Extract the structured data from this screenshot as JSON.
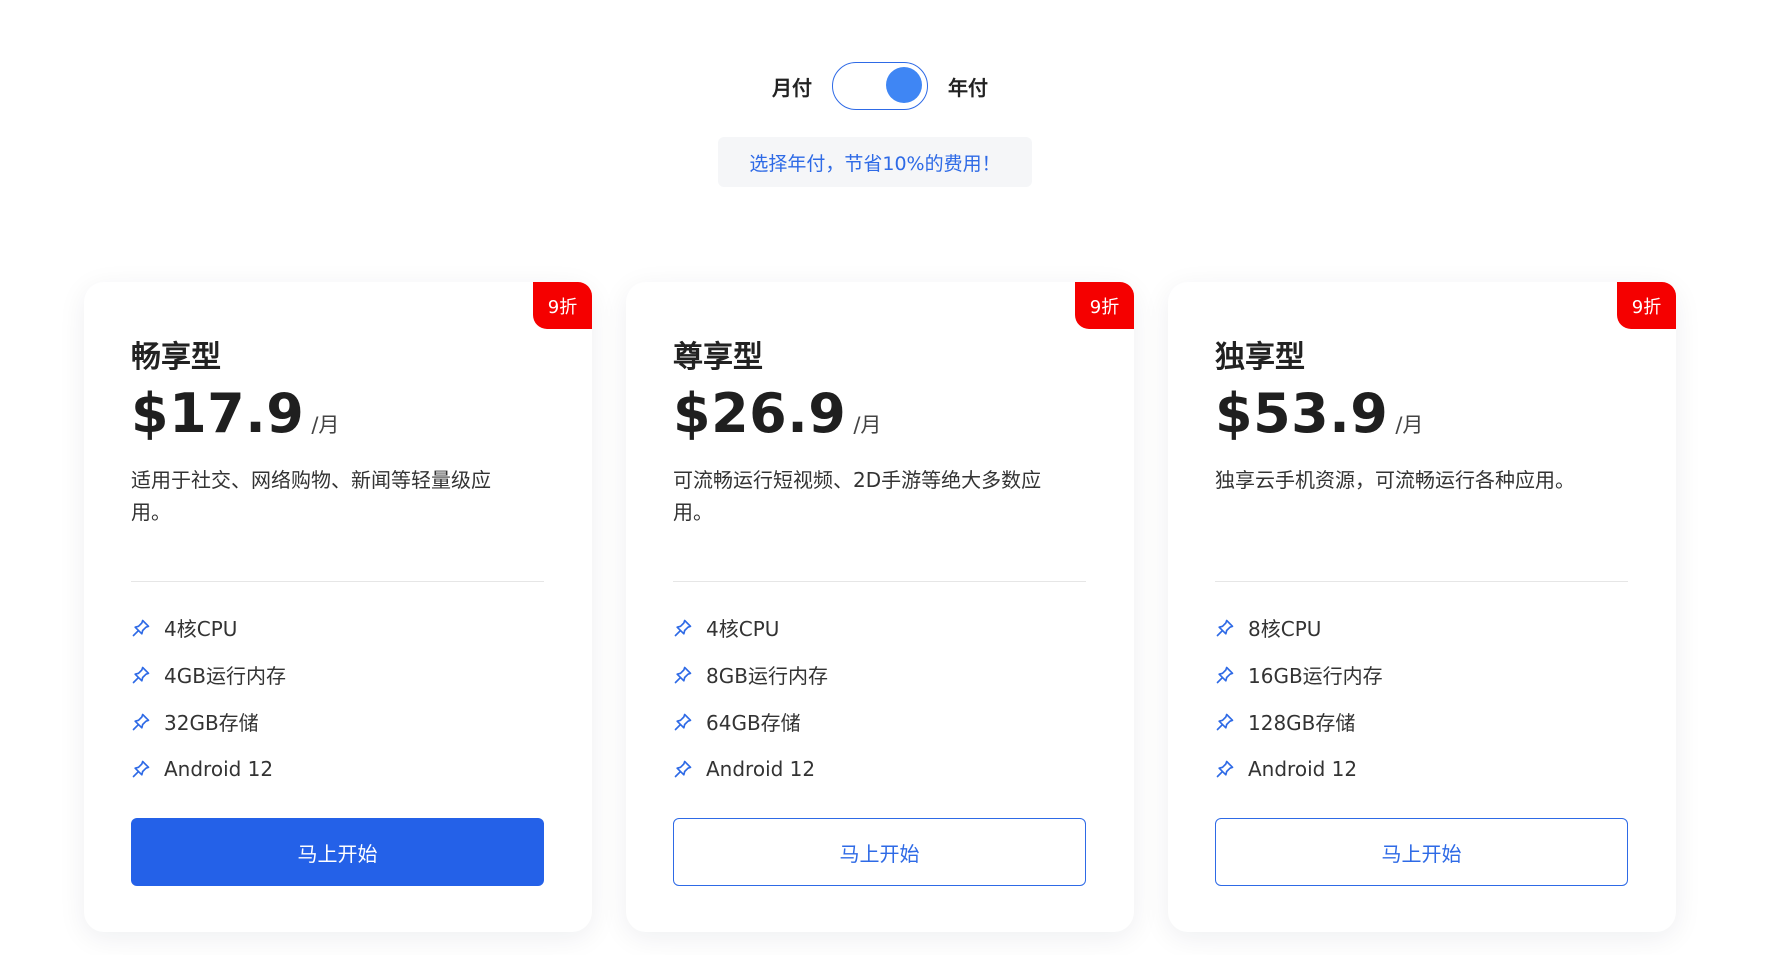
{
  "billing": {
    "monthly_label": "月付",
    "yearly_label": "年付",
    "toggle_state": "yearly",
    "promo_text": "选择年付，节省10%的费用！"
  },
  "colors": {
    "accent": "#2461e8",
    "badge": "#f50000"
  },
  "plans": [
    {
      "badge": "9折",
      "name": "畅享型",
      "price": "$17.9",
      "period": "/月",
      "description": "适用于社交、网络购物、新闻等轻量级应用。",
      "features": [
        "4核CPU",
        "4GB运行内存",
        "32GB存储",
        "Android 12"
      ],
      "feature_icon": "pin-icon",
      "cta": "马上开始"
    },
    {
      "badge": "9折",
      "name": "尊享型",
      "price": "$26.9",
      "period": "/月",
      "description": "可流畅运行短视频、2D手游等绝大多数应用。",
      "features": [
        "4核CPU",
        "8GB运行内存",
        "64GB存储",
        "Android 12"
      ],
      "feature_icon": "pin-icon",
      "cta": "马上开始"
    },
    {
      "badge": "9折",
      "name": "独享型",
      "price": "$53.9",
      "period": "/月",
      "description": "独享云手机资源，可流畅运行各种应用。",
      "features": [
        "8核CPU",
        "16GB运行内存",
        "128GB存储",
        "Android 12"
      ],
      "feature_icon": "pin-icon",
      "cta": "马上开始"
    }
  ]
}
